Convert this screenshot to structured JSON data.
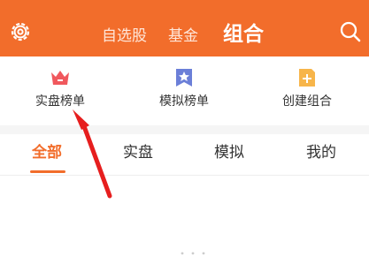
{
  "header": {
    "tabs": [
      {
        "label": "自选股",
        "active": false
      },
      {
        "label": "基金",
        "active": false
      },
      {
        "label": "组合",
        "active": true
      }
    ],
    "settings_icon": "gear-icon",
    "search_icon": "search-icon"
  },
  "quick_actions": [
    {
      "label": "实盘榜单",
      "icon": "crown-icon"
    },
    {
      "label": "模拟榜单",
      "icon": "star-bookmark-icon"
    },
    {
      "label": "创建组合",
      "icon": "add-document-icon"
    }
  ],
  "filter_tabs": [
    {
      "label": "全部",
      "active": true
    },
    {
      "label": "实盘",
      "active": false
    },
    {
      "label": "模拟",
      "active": false
    },
    {
      "label": "我的",
      "active": false
    }
  ],
  "colors": {
    "brand": "#f26d2b",
    "annotation_arrow": "#e61e1e"
  }
}
